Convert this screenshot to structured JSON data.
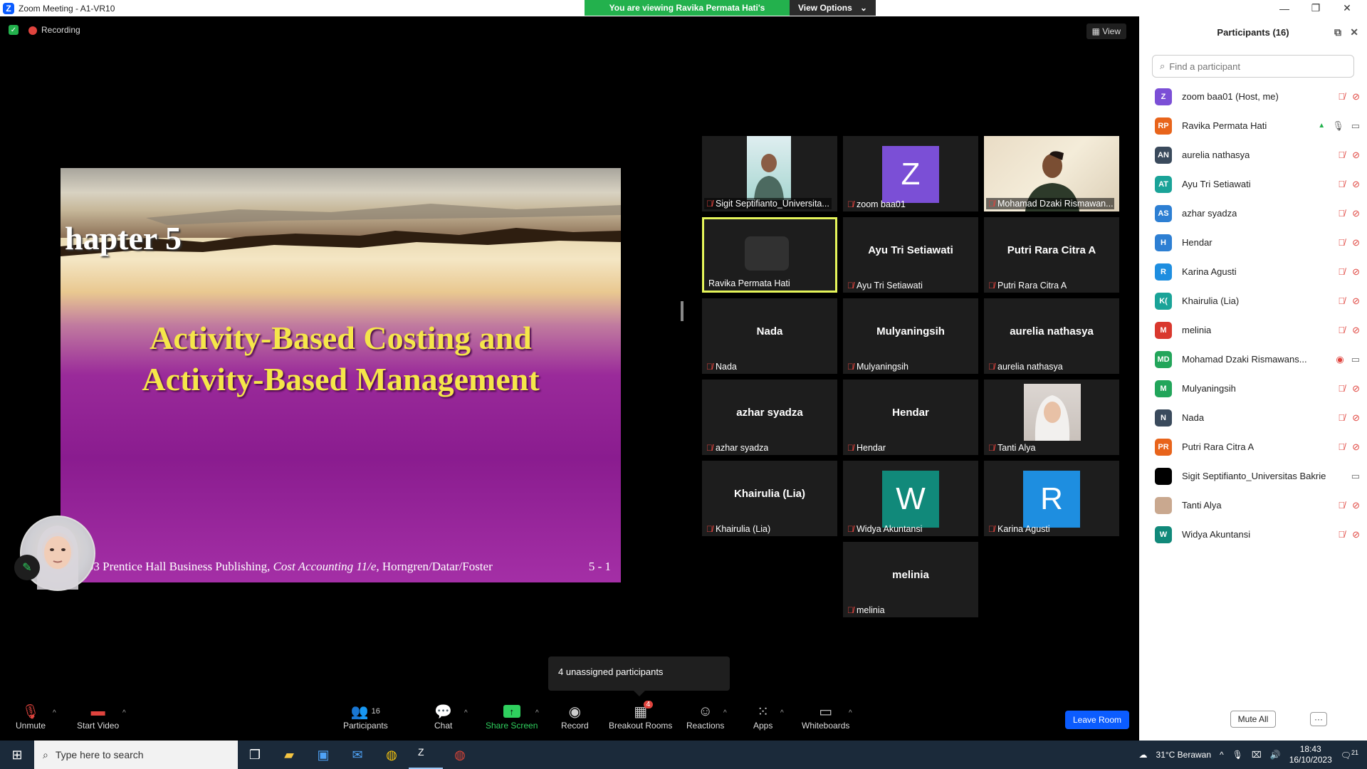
{
  "window": {
    "title": "Zoom Meeting - A1-VR10"
  },
  "banner": {
    "message": "You are viewing Ravika Permata Hati's screen",
    "view_options": "View Options"
  },
  "meeting": {
    "recording_label": "Recording",
    "view_label": "View"
  },
  "slide": {
    "chapter": "hapter 5",
    "title_line1": "Activity-Based Costing and",
    "title_line2": "Activity-Based Management",
    "footer_pre": "©2003 Prentice Hall Business Publishing, ",
    "footer_italic": "Cost Accounting 11/e,",
    "footer_post": " Horngren/Datar/Foster",
    "page": "5 - 1"
  },
  "gallery": {
    "tiles": [
      {
        "label": "Sigit Septifianto_Universita...",
        "big": ""
      },
      {
        "label": "zoom baa01",
        "big": "",
        "avatar": "Z"
      },
      {
        "label": "Mohamad Dzaki Rismawan...",
        "big": ""
      },
      {
        "label": "Ravika Permata Hati",
        "big": ""
      },
      {
        "label": "Ayu Tri Setiawati",
        "big": "Ayu Tri Setiawati"
      },
      {
        "label": "Putri Rara Citra A",
        "big": "Putri Rara Citra A"
      },
      {
        "label": "Nada",
        "big": "Nada"
      },
      {
        "label": "Mulyaningsih",
        "big": "Mulyaningsih"
      },
      {
        "label": "aurelia nathasya",
        "big": "aurelia nathasya"
      },
      {
        "label": "azhar syadza",
        "big": "azhar syadza"
      },
      {
        "label": "Hendar",
        "big": "Hendar"
      },
      {
        "label": "Tanti Alya",
        "big": ""
      },
      {
        "label": "Khairulia (Lia)",
        "big": "Khairulia (Lia)"
      },
      {
        "label": "Widya Akuntansi",
        "big": "",
        "avatar": "W"
      },
      {
        "label": "Karina Agusti",
        "big": "",
        "avatar": "R"
      },
      {
        "label": "melinia",
        "big": "melinia"
      }
    ]
  },
  "tooltip": "4 unassigned participants",
  "toolbar": {
    "unmute": "Unmute",
    "start_video": "Start Video",
    "participants": "Participants",
    "participants_count": "16",
    "chat": "Chat",
    "share_screen": "Share Screen",
    "record": "Record",
    "breakout": "Breakout Rooms",
    "breakout_badge": "4",
    "reactions": "Reactions",
    "apps": "Apps",
    "whiteboards": "Whiteboards",
    "leave": "Leave Room"
  },
  "panel": {
    "title": "Participants (16)",
    "search_placeholder": "Find a participant",
    "mute_all": "Mute All",
    "more": "···",
    "participants": [
      {
        "initials": "Z",
        "name": "zoom baa01 (Host, me)",
        "color": "#7b4fd6",
        "mic": "off",
        "video": "off"
      },
      {
        "initials": "RP",
        "name": "Ravika Permata Hati",
        "color": "#e8641b",
        "mic": "on",
        "video": "on",
        "sharing": true
      },
      {
        "initials": "AN",
        "name": "aurelia nathasya",
        "color": "#3a4a5c",
        "mic": "off",
        "video": "off"
      },
      {
        "initials": "AT",
        "name": "Ayu Tri Setiawati",
        "color": "#1aa398",
        "mic": "off",
        "video": "off"
      },
      {
        "initials": "AS",
        "name": "azhar syadza",
        "color": "#2d7fd3",
        "mic": "off",
        "video": "off"
      },
      {
        "initials": "H",
        "name": "Hendar",
        "color": "#2d7fd3",
        "mic": "off",
        "video": "off"
      },
      {
        "initials": "R",
        "name": "Karina Agusti",
        "color": "#1e8ee0",
        "mic": "off",
        "video": "off"
      },
      {
        "initials": "K(",
        "name": "Khairulia (Lia)",
        "color": "#1aa398",
        "mic": "off",
        "video": "off"
      },
      {
        "initials": "M",
        "name": "melinia",
        "color": "#d9382e",
        "mic": "off",
        "video": "off"
      },
      {
        "initials": "MD",
        "name": "Mohamad Dzaki Rismawans...",
        "color": "#22a55a",
        "mic": "recording",
        "video": "on"
      },
      {
        "initials": "M",
        "name": "Mulyaningsih",
        "color": "#22a55a",
        "mic": "off",
        "video": "off"
      },
      {
        "initials": "N",
        "name": "Nada",
        "color": "#3a4a5c",
        "mic": "off",
        "video": "off"
      },
      {
        "initials": "PR",
        "name": "Putri Rara Citra A",
        "color": "#e8641b",
        "mic": "off",
        "video": "off"
      },
      {
        "initials": "",
        "name": "Sigit Septifianto_Universitas Bakrie",
        "color": "#000000",
        "mic": "none",
        "video": "on"
      },
      {
        "initials": "",
        "name": "Tanti Alya",
        "color": "#c9a88f",
        "mic": "off",
        "video": "off"
      },
      {
        "initials": "W",
        "name": "Widya Akuntansi",
        "color": "#11897a",
        "mic": "off",
        "video": "off"
      }
    ]
  },
  "taskbar": {
    "search_placeholder": "Type here to search",
    "weather": "31°C  Berawan",
    "time": "18:43",
    "date": "16/10/2023",
    "notifications": "21"
  }
}
